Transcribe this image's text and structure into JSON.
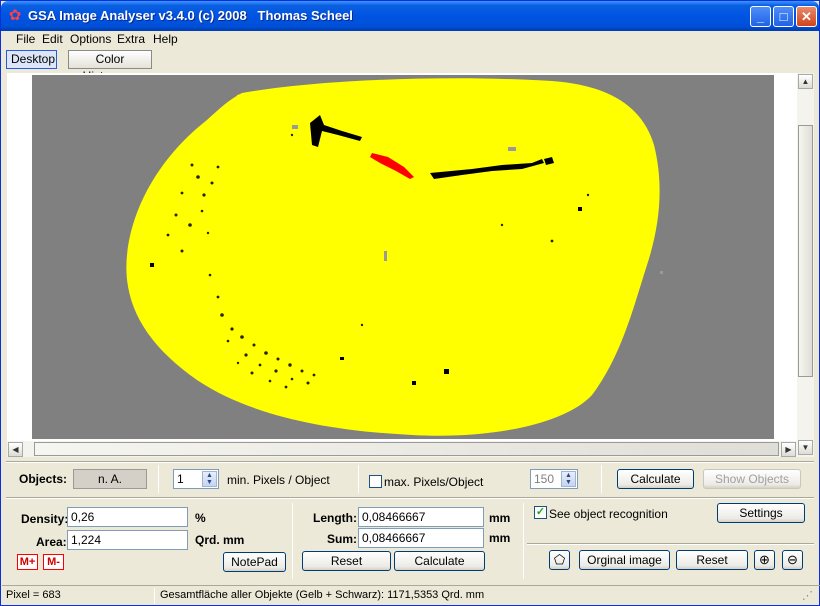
{
  "window": {
    "title": "GSA Image Analyser v3.4.0 (c) 2008   Thomas Scheel",
    "icon": "app-star-icon"
  },
  "menu": [
    "File",
    "Edit",
    "Options",
    "Extra",
    "Help"
  ],
  "toolbar": {
    "desktop": "Desktop",
    "histogram": "Color Histogram"
  },
  "objects": {
    "label": "Objects:",
    "value": "n. A.",
    "min_pixels": "1",
    "min_pixels_label": "min. Pixels / Object",
    "max_pixels_label": "max. Pixels/Object",
    "max_pixels_checked": false,
    "max_pixels": "150",
    "calculate": "Calculate",
    "show_objects": "Show Objects"
  },
  "density": {
    "label": "Density:",
    "value": "0,26",
    "unit": "%"
  },
  "area": {
    "label": "Area:",
    "value": "1,224",
    "unit": "Qrd. mm"
  },
  "notepad": "NotePad",
  "mplus": "M+",
  "mminus": "M-",
  "length": {
    "label": "Length:",
    "value": "0,08466667",
    "unit": "mm"
  },
  "sum": {
    "label": "Sum:",
    "value": "0,08466667",
    "unit": "mm"
  },
  "mid_buttons": {
    "reset": "Reset",
    "calculate": "Calculate"
  },
  "recognition": {
    "label": "See object recognition",
    "checked": true,
    "settings": "Settings"
  },
  "right_buttons": {
    "original": "Orginal image",
    "reset": "Reset"
  },
  "colors": {
    "object_yellow": "#ffff00",
    "background_gray": "#808080",
    "selected_red": "#ff0000"
  },
  "status": {
    "pixel": "Pixel = 683",
    "total": "Gesamtfläche aller Objekte (Gelb + Schwarz): 1171,5353 Qrd. mm"
  }
}
